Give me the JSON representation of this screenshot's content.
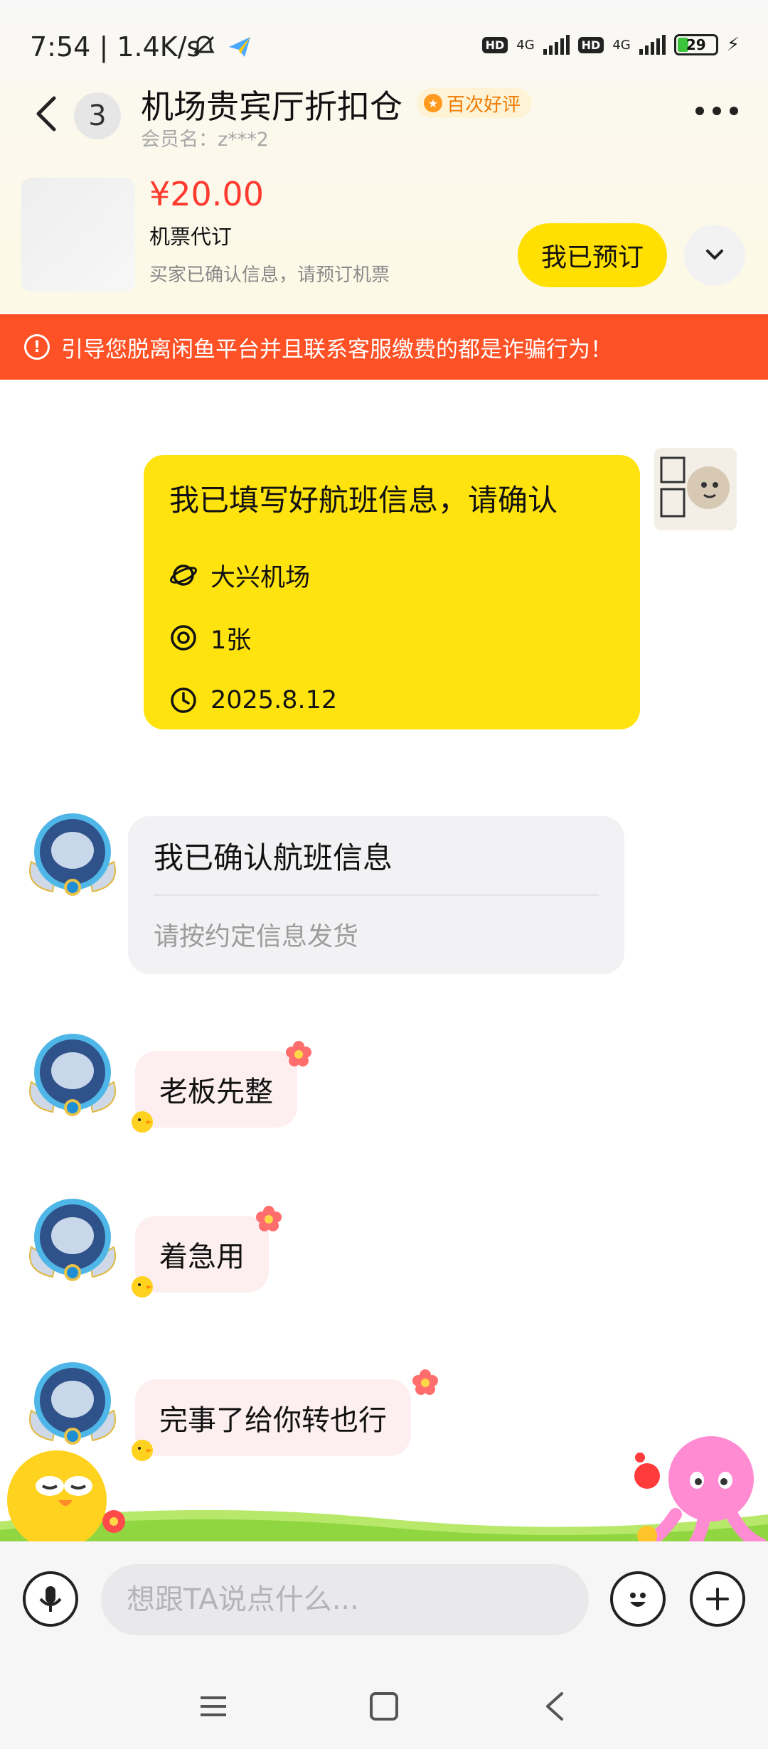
{
  "status_bar": {
    "time": "7:54",
    "net_speed": "1.4K/s",
    "hd1": "HD",
    "net1": "4G",
    "hd2": "HD",
    "net2": "4G",
    "battery": "29"
  },
  "header": {
    "unread_count": "3",
    "title": "机场贵宾厅折扣仓",
    "praise_badge": "百次好评",
    "member_name": "会员名：z***2"
  },
  "product": {
    "price": "¥20.00",
    "name": "机票代订",
    "hint": "买家已确认信息，请预订机票",
    "action_label": "我已预订"
  },
  "warning": {
    "text": "引导您脱离闲鱼平台并且联系客服缴费的都是诈骗行为！"
  },
  "messages": {
    "flight_card": {
      "title": "我已填写好航班信息，请确认",
      "airport": "大兴机场",
      "tickets": "1张",
      "date": "2025.8.12"
    },
    "confirm_card": {
      "title": "我已确认航班信息",
      "subtitle": "请按约定信息发货"
    },
    "bubbles": [
      "老板先整",
      "着急用",
      "完事了给你转也行"
    ]
  },
  "input": {
    "placeholder": "想跟TA说点什么..."
  },
  "colors": {
    "accent_yellow": "#ffe30f",
    "price_red": "#ff3a2f",
    "warning_orange": "#ff5126",
    "bubble_pink": "#fdeef0"
  },
  "icons": {
    "back": "chevron-left-icon",
    "more": "more-dots-icon",
    "expand": "chevron-down-icon",
    "warning": "exclamation-circle-icon",
    "airport": "planet-icon",
    "tickets": "target-icon",
    "date": "clock-icon",
    "mic": "mic-icon",
    "emoji": "smile-icon",
    "plus": "plus-icon"
  }
}
